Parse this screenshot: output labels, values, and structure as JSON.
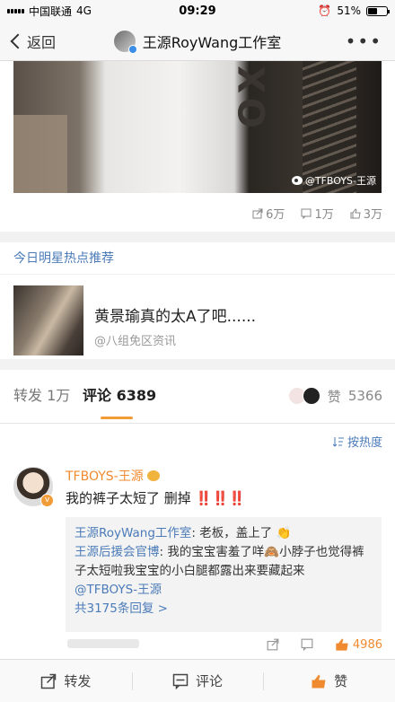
{
  "status": {
    "carrier": "中国联通",
    "network": "4G",
    "time": "09:29",
    "battery": "51%",
    "battery_level": 0.51
  },
  "nav": {
    "back": "返回",
    "title": "王源RoyWang工作室",
    "more": "•••"
  },
  "post": {
    "watermark": "@TFBOYS-王源",
    "reposts": "6万",
    "comments": "1万",
    "likes": "3万"
  },
  "recommend": {
    "title": "今日明星热点推荐",
    "headline": "黄景瑜真的太A了吧......",
    "source": "@八组免区资讯"
  },
  "tabs": {
    "repost_label": "转发",
    "repost_count": "1万",
    "comment_label": "评论",
    "comment_count": "6389",
    "like_label": "赞",
    "like_count": "5366"
  },
  "comments": {
    "sort_label": "按热度",
    "item": {
      "name": "TFBOYS-王源",
      "text": "我的裤子太短了 删掉",
      "marks": "‼️‼️‼️",
      "reply1_name": "王源RoyWang工作室",
      "reply1_text": ": 老板，盖上了",
      "reply2_name": "王源后援会官博",
      "reply2_text": ": 我的宝宝害羞了咩",
      "reply2_text_b": "小脖子也觉得裤子太短啦我宝宝的小白腿都露出来要藏起来",
      "reply2_mention": "@TFBOYS-王源",
      "more_replies": "共3175条回复 >",
      "likes": "4986"
    }
  },
  "bottom": {
    "repost": "转发",
    "comment": "评论",
    "like": "赞"
  },
  "colors": {
    "accent": "#f08a2e",
    "link": "#4b7bb8"
  }
}
